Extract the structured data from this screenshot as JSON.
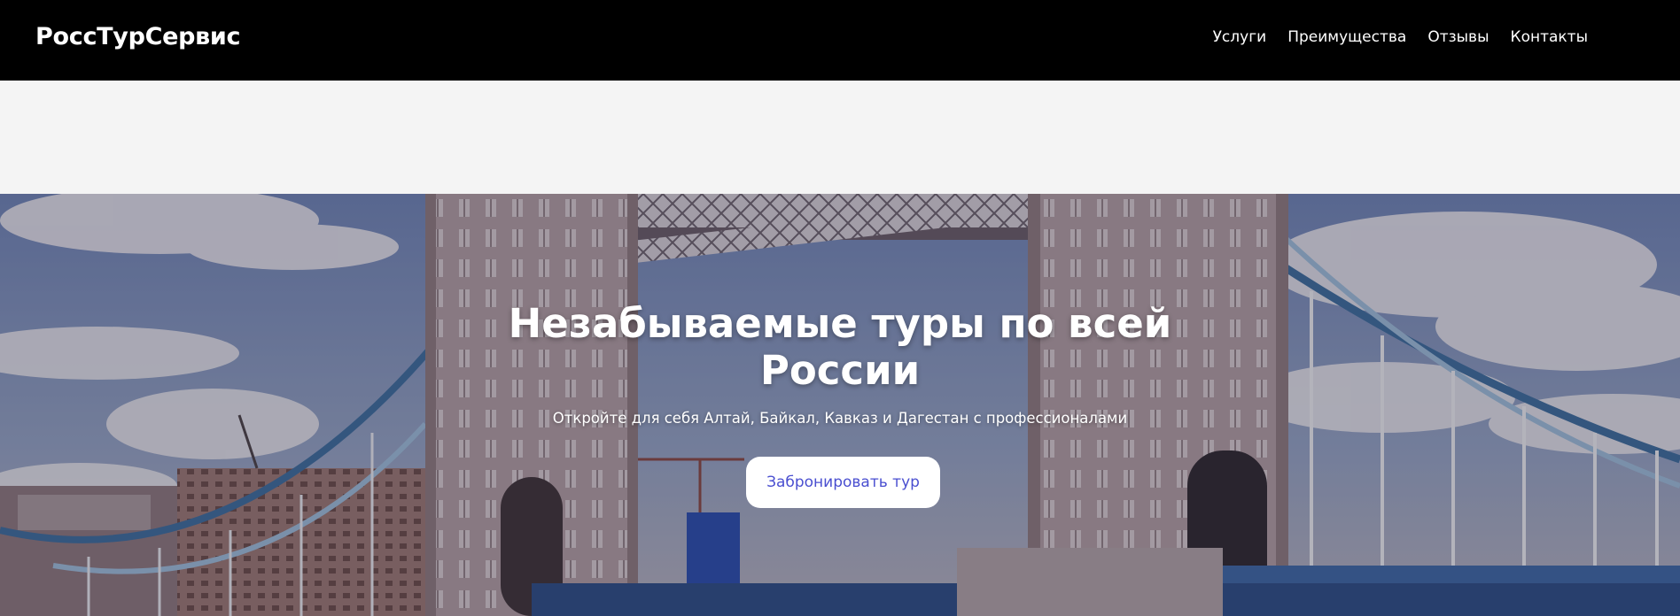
{
  "header": {
    "logo": "РоссТурСервис",
    "nav": [
      "Услуги",
      "Преимущества",
      "Отзывы",
      "Контакты"
    ]
  },
  "hero": {
    "title": "Незабываемые туры по всей России",
    "subtitle": "Откройте для себя Алтай, Байкал, Кавказ и Дагестан с профессионалами",
    "button_label": "Забронировать тур",
    "background": "Tower Bridge photo"
  },
  "colors": {
    "header_bg": "#000000",
    "band_bg": "#f4f4f4",
    "button_text": "#4a4fd0"
  }
}
